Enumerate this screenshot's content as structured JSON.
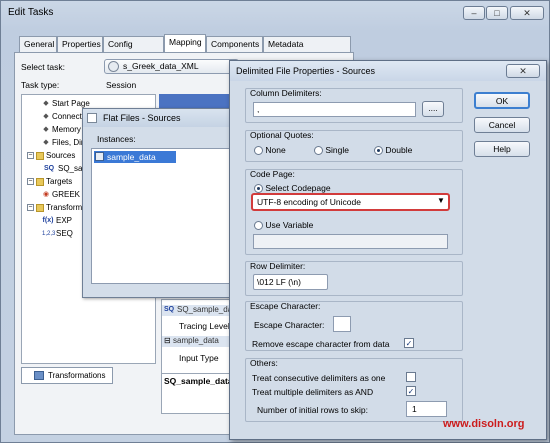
{
  "window": {
    "title": "Edit Tasks"
  },
  "tabs": [
    "General",
    "Properties",
    "Config Object",
    "Mapping",
    "Components",
    "Metadata Extensions"
  ],
  "active_tab": "Mapping",
  "task": {
    "select_label": "Select task:",
    "select_value": "s_Greek_data_XML",
    "type_label": "Task type:",
    "type_value": "Session"
  },
  "tree": [
    {
      "label": "Start Page",
      "indent": 1,
      "icon": "diamond-icon"
    },
    {
      "label": "Connections",
      "indent": 1,
      "icon": "diamond-icon"
    },
    {
      "label": "Memory",
      "indent": 1,
      "icon": "diamond-icon"
    },
    {
      "label": "Files, Directories",
      "indent": 1,
      "icon": "diamond-icon"
    },
    {
      "label": "Sources",
      "indent": 0,
      "icon": "folder-icon"
    },
    {
      "label": "SQ_sample_data",
      "indent": 1,
      "icon": "source-qualifier-icon"
    },
    {
      "label": "Targets",
      "indent": 0,
      "icon": "folder-icon"
    },
    {
      "label": "GREEK",
      "indent": 1,
      "icon": "target-icon"
    },
    {
      "label": "Transformations",
      "indent": 0,
      "icon": "folder-icon"
    },
    {
      "label": "EXP",
      "indent": 1,
      "icon": "expression-icon"
    },
    {
      "label": "SEQ",
      "indent": 1,
      "icon": "sequence-icon"
    }
  ],
  "transformations_tab": "Transformations",
  "main_props": {
    "sq_node": "SQ_sample_data",
    "tracing_level": "Tracing Level",
    "sample_node": "sample_data",
    "input_type": "Input Type",
    "bottom_label": "SQ_sample_data"
  },
  "flatfiles": {
    "title": "Flat Files - Sources",
    "instances_label": "Instances:",
    "instances": [
      "sample_data"
    ]
  },
  "delimited": {
    "title": "Delimited File Properties - Sources",
    "column_delimiters_label": "Column Delimiters:",
    "column_delimiters_value": ",",
    "browse_label": "....",
    "optional_quotes_label": "Optional Quotes:",
    "quote_options": [
      "None",
      "Single",
      "Double"
    ],
    "quote_selected": "Double",
    "code_page_label": "Code Page:",
    "select_codepage_label": "Select Codepage",
    "codepage_value": "UTF-8 encoding of Unicode",
    "use_variable_label": "Use Variable",
    "row_delimiter_label": "Row Delimiter:",
    "row_delimiter_value": "\\012  LF  (\\n)",
    "escape_group_label": "Escape Character:",
    "escape_char_label": "Escape Character:",
    "remove_escape_label": "Remove escape character from data",
    "remove_escape_checked": true,
    "others_label": "Others:",
    "treat_consecutive_label": "Treat consecutive delimiters as one",
    "treat_consecutive_checked": false,
    "treat_multiple_label": "Treat multiple delimiters as AND",
    "treat_multiple_checked": true,
    "initial_rows_label": "Number of initial rows to skip:",
    "initial_rows_value": "1",
    "ok_label": "OK",
    "cancel_label": "Cancel",
    "help_label": "Help"
  },
  "watermark": "www.disoln.org",
  "colors": {
    "highlight_border": "#d23b3b",
    "selection": "#3b79d6",
    "watermark": "#cc1c1c"
  }
}
